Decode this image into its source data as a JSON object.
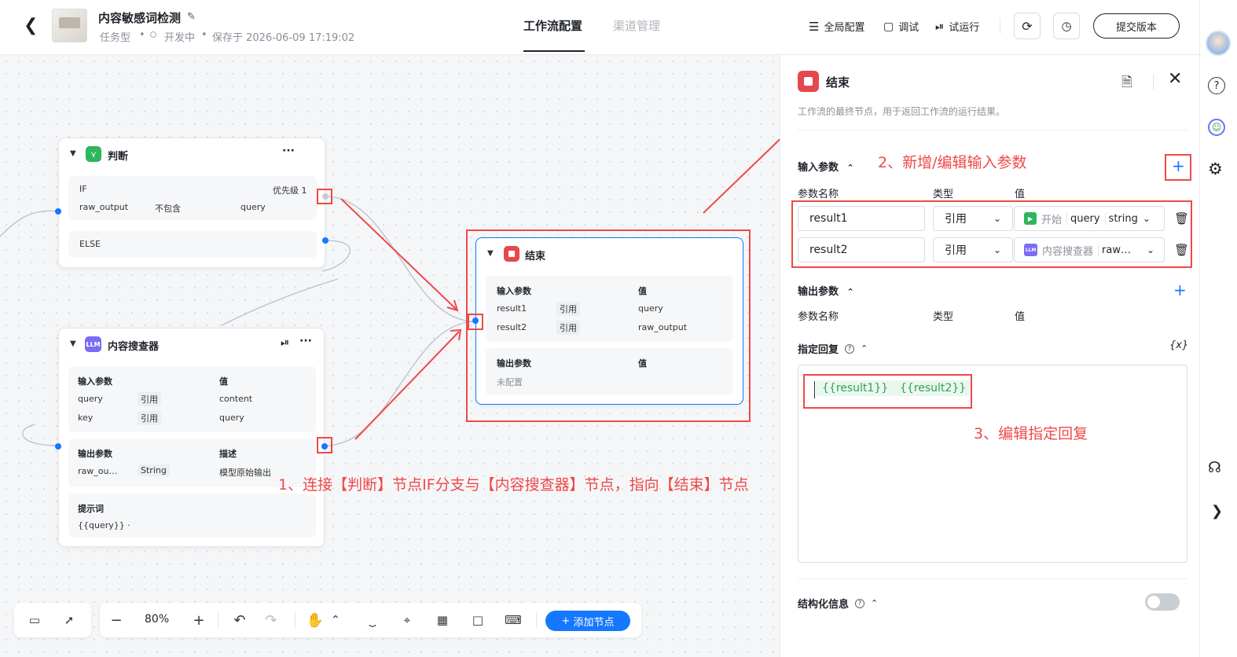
{
  "header": {
    "title": "内容敏感词检测",
    "type": "任务型",
    "status": "开发中",
    "saved": "保存于 2026-06-09 17:19:02",
    "tabs": [
      "工作流配置",
      "渠道管理"
    ],
    "actions": {
      "global": "全局配置",
      "debug": "调试",
      "run": "试运行",
      "submit": "提交版本"
    }
  },
  "nodes": {
    "judge": {
      "title": "判断",
      "if_label": "IF",
      "priority": "优先级 1",
      "cond": [
        "raw_output",
        "不包含",
        "query"
      ],
      "else_label": "ELSE"
    },
    "search": {
      "title": "内容搜查器",
      "badge": "LLM",
      "in_h": [
        "输入参数",
        "值"
      ],
      "in_rows": [
        [
          "query",
          "引用",
          "content"
        ],
        [
          "key",
          "引用",
          "query"
        ]
      ],
      "out_h": [
        "输出参数",
        "描述"
      ],
      "out_row": [
        "raw_ou…",
        "String",
        "模型原始输出"
      ],
      "prompt_h": "提示词",
      "prompt": "{{query}} ·"
    },
    "end": {
      "title": "结束",
      "in_h": [
        "输入参数",
        "值"
      ],
      "in_rows": [
        [
          "result1",
          "引用",
          "query"
        ],
        [
          "result2",
          "引用",
          "raw_output"
        ]
      ],
      "out_h": [
        "输出参数",
        "值"
      ],
      "out_empty": "未配置"
    }
  },
  "annotations": {
    "a1": "1、连接【判断】节点IF分支与【内容搜查器】节点，指向【结束】节点",
    "a2": "2、新增/编辑输入参数",
    "a3": "3、编辑指定回复"
  },
  "panel": {
    "title": "结束",
    "desc": "工作流的最终节点，用于返回工作流的运行结果。",
    "input_h": "输入参数",
    "cols": [
      "参数名称",
      "类型",
      "值"
    ],
    "params": [
      {
        "name": "result1",
        "type": "引用",
        "src": "开始",
        "field": "query",
        "dtype": "string"
      },
      {
        "name": "result2",
        "type": "引用",
        "src": "内容搜查器",
        "badge": "LLM",
        "field": "raw…"
      }
    ],
    "output_h": "输出参数",
    "out_cols": [
      "参数名称",
      "类型",
      "值"
    ],
    "reply_h": "指定回复",
    "var_btn": "{x}",
    "reply_tokens": [
      "{{result1}}",
      "{{result2}}"
    ],
    "struct_h": "结构化信息"
  },
  "toolbar": {
    "zoom": "80%",
    "add": "添加节点"
  },
  "colors": {
    "accent": "#1677ff",
    "red": "#f04848",
    "end_icon": "#e5484d",
    "llm": "#7b6cf6",
    "judge": "#2fb65a"
  }
}
